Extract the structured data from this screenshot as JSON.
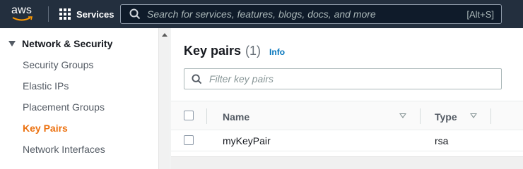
{
  "topnav": {
    "logo_text": "aws",
    "services_label": "Services",
    "search_placeholder": "Search for services, features, blogs, docs, and more",
    "search_shortcut": "[Alt+S]"
  },
  "sidebar": {
    "section_label": "Network & Security",
    "items": [
      {
        "label": "Security Groups"
      },
      {
        "label": "Elastic IPs"
      },
      {
        "label": "Placement Groups"
      },
      {
        "label": "Key Pairs"
      },
      {
        "label": "Network Interfaces"
      }
    ],
    "active_item": "Key Pairs"
  },
  "panel": {
    "title": "Key pairs",
    "count": "(1)",
    "info_label": "Info",
    "filter_placeholder": "Filter key pairs",
    "columns": [
      {
        "label": "Name"
      },
      {
        "label": "Type"
      }
    ],
    "rows": [
      {
        "name": "myKeyPair",
        "type": "rsa"
      }
    ]
  },
  "colors": {
    "nav_bg": "#232f3e",
    "active_accent": "#ec7211",
    "link": "#0073bb"
  }
}
